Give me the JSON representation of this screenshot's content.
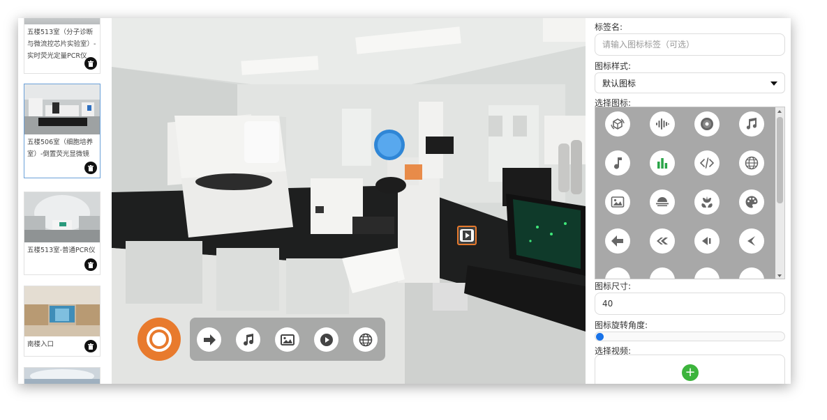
{
  "sidebar": {
    "scenes": [
      {
        "title": "五楼513室（分子诊断与微流控芯片实验室）-实时荧光定量PCR仪",
        "active": false
      },
      {
        "title": "五楼506室（细胞培养室）-倒置荧光显微镜",
        "active": true
      },
      {
        "title": "五楼513室-普通PCR仪",
        "active": false
      },
      {
        "title": "南楼入口",
        "active": false
      },
      {
        "title": "",
        "active": false
      }
    ],
    "delete_icon": "trash-icon"
  },
  "pano": {
    "poster_text": "",
    "hotspot_icon": "video-icon",
    "record_icon": "record-icon",
    "toolbar": [
      {
        "icon": "arrow-right-icon"
      },
      {
        "icon": "music-icon"
      },
      {
        "icon": "image-icon"
      },
      {
        "icon": "play-icon"
      },
      {
        "icon": "globe-icon"
      }
    ]
  },
  "panel": {
    "tag_label": "标签名:",
    "tag_placeholder": "请输入图标标签（可选）",
    "style_label": "图标样式:",
    "style_value": "默认图标",
    "choose_icon_label": "选择图标:",
    "icons": [
      "cube-rotate-icon",
      "soundwave-icon",
      "disc-icon",
      "music-note-icon",
      "single-note-icon",
      "bar-chart-icon",
      "code-icon",
      "globe-icon",
      "image-icon",
      "horizon-icon",
      "flower-icon",
      "palette-icon",
      "arrow-left-icon",
      "double-chevron-left-icon",
      "rewind-icon",
      "chevron-left-icon"
    ],
    "size_label": "图标尺寸:",
    "size_value": "40",
    "rotation_label": "图标旋转角度:",
    "rotation_value": 0,
    "video_label": "选择视频:",
    "add_symbol": "+",
    "accent_color": "#1a73e8",
    "add_color": "#3cb43c",
    "record_color": "#e87a2d"
  }
}
